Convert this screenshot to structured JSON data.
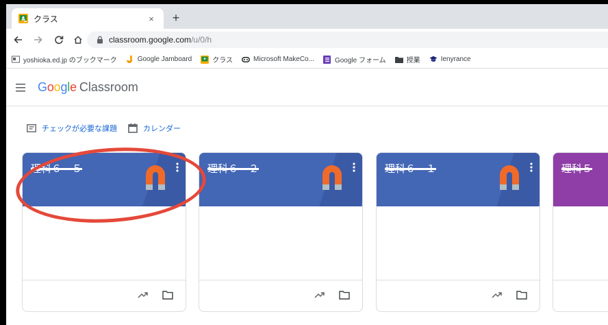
{
  "browser": {
    "tab_title": "クラス",
    "tab_close": "×",
    "new_tab": "+",
    "url_host": "classroom.google.com",
    "url_path": "/u/0/h"
  },
  "bookmarks": [
    {
      "label": "yoshioka.ed.jp のブックマーク",
      "icon": "bookmark-folder-icon"
    },
    {
      "label": "Google Jamboard",
      "icon": "jamboard-icon"
    },
    {
      "label": "クラス",
      "icon": "classroom-icon"
    },
    {
      "label": "Microsoft MakeCo...",
      "icon": "makecode-icon"
    },
    {
      "label": "Google フォーム",
      "icon": "forms-icon"
    },
    {
      "label": "授業",
      "icon": "folder-icon"
    },
    {
      "label": "Ienyrance",
      "icon": "cap-icon"
    }
  ],
  "app": {
    "brand_google": "Google",
    "brand_product": "Classroom"
  },
  "subnav": {
    "todo_label": "チェックが必要な課題",
    "calendar_label": "カレンダー"
  },
  "cards": [
    {
      "name": "理科６－５",
      "color": "#4366b5"
    },
    {
      "name": "理科６－２",
      "color": "#4366b5"
    },
    {
      "name": "理科６－１",
      "color": "#4366b5"
    },
    {
      "name": "理科５",
      "color": "#8e3ea6"
    }
  ],
  "colors": {
    "accent": "#1967d2",
    "highlight_circle": "#e4493a"
  }
}
